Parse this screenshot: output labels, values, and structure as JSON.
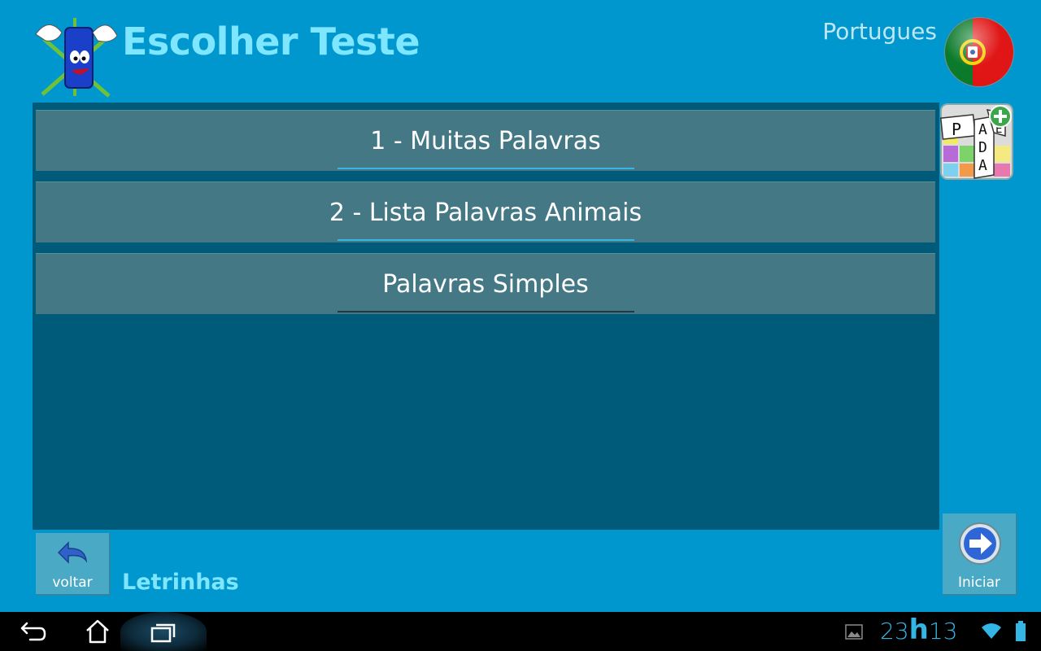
{
  "header": {
    "title": "Escolher Teste",
    "language": "Portugues",
    "flag_icon": "portugal-flag-icon",
    "mascot_icon": "mascot-icon"
  },
  "tests": [
    {
      "label": "1 - Muitas Palavras"
    },
    {
      "label": "2 - Lista Palavras Animais"
    },
    {
      "label": "Palavras Simples"
    }
  ],
  "side": {
    "game_icon": "word-puzzle-app-icon"
  },
  "footer": {
    "back_label": "voltar",
    "app_name": "Letrinhas",
    "start_label": "Iniciar"
  },
  "status_bar": {
    "hour": "23",
    "hour_sep": "h",
    "minute": "13"
  },
  "colors": {
    "background": "#0097cf",
    "title": "#7ee6ff",
    "list_panel": "#005a7a",
    "list_item": "#437884",
    "accent": "#33b5e5"
  }
}
